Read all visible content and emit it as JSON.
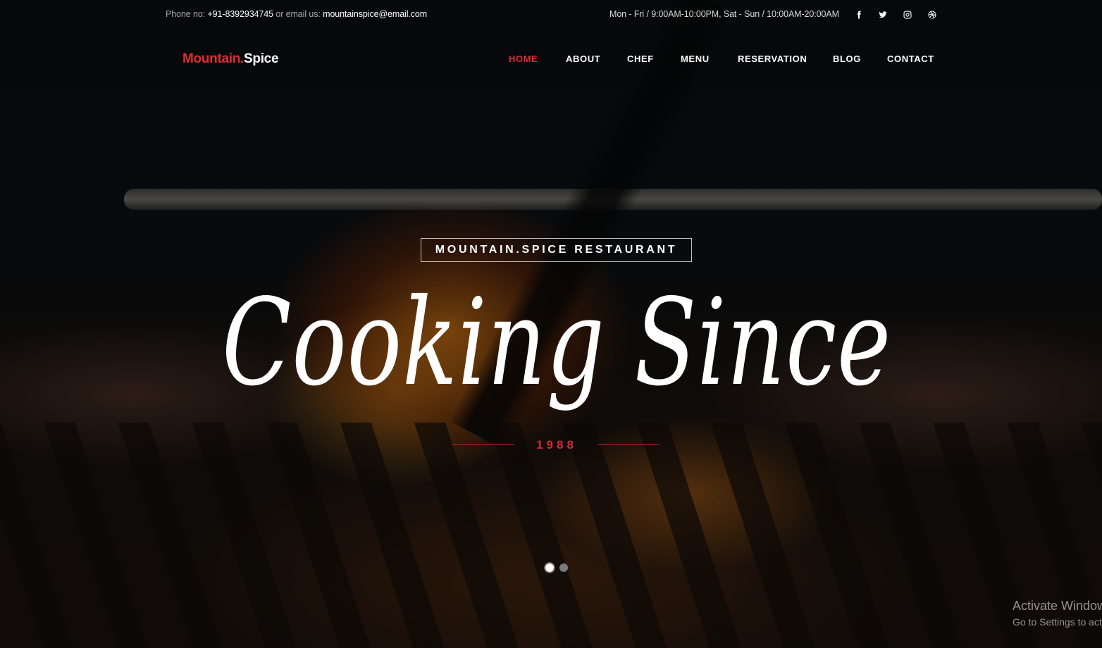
{
  "topbar": {
    "phone_label": "Phone no:",
    "phone": "+91-8392934745",
    "email_label": "or email us:",
    "email": "mountainspice@email.com",
    "hours": "Mon - Fri / 9:00AM-10:00PM, Sat - Sun / 10:00AM-20:00AM",
    "social_icons": [
      "facebook-icon",
      "twitter-icon",
      "instagram-icon",
      "dribbble-icon"
    ]
  },
  "brand": {
    "part1": "Mountain.",
    "part2": "Spice"
  },
  "nav": {
    "items": [
      {
        "label": "HOME",
        "active": true
      },
      {
        "label": "ABOUT",
        "active": false
      },
      {
        "label": "CHEF",
        "active": false
      },
      {
        "label": "MENU",
        "active": false
      },
      {
        "label": "RESERVATION",
        "active": false
      },
      {
        "label": "BLOG",
        "active": false
      },
      {
        "label": "CONTACT",
        "active": false
      }
    ]
  },
  "hero": {
    "tagline": "MOUNTAIN.SPICE RESTAURANT",
    "headline": "Cooking Since",
    "year": "1988",
    "slides_total": 2,
    "slide_active": 1
  },
  "watermark": {
    "line1": "Activate Windows",
    "line2": "Go to Settings to activate Windows."
  },
  "colors": {
    "accent": "#e32a33",
    "year": "#d6283a",
    "text": "#ffffff"
  }
}
